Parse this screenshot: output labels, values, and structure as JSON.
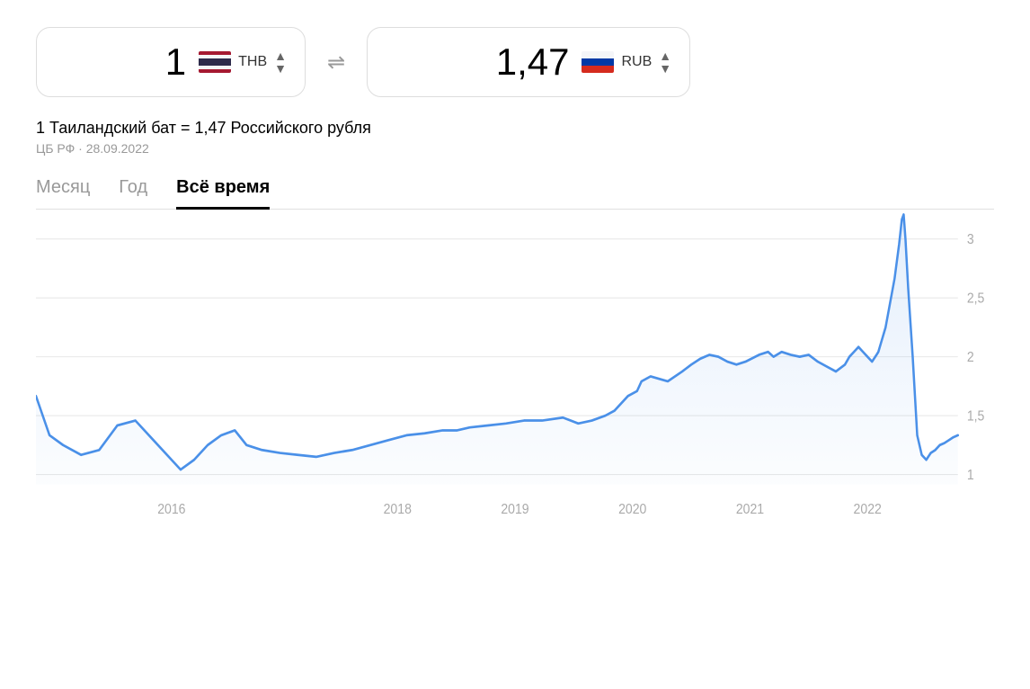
{
  "converter": {
    "from": {
      "amount": "1",
      "currency_code": "THB",
      "flag": "thb"
    },
    "swap_icon": "⇌",
    "to": {
      "amount": "1,47",
      "currency_code": "RUB",
      "flag": "rub"
    }
  },
  "rate_info": {
    "text": "1 Таиландский бат = 1,47 Российского рубля",
    "source": "ЦБ РФ · 28.09.2022"
  },
  "tabs": [
    {
      "label": "Месяц",
      "active": false
    },
    {
      "label": "Год",
      "active": false
    },
    {
      "label": "Всё время",
      "active": true
    }
  ],
  "chart": {
    "y_labels": [
      "3",
      "2,5",
      "2",
      "1,5",
      "1"
    ],
    "x_labels": [
      "2016",
      "2018",
      "2019",
      "2020",
      "2021",
      "2022"
    ]
  }
}
